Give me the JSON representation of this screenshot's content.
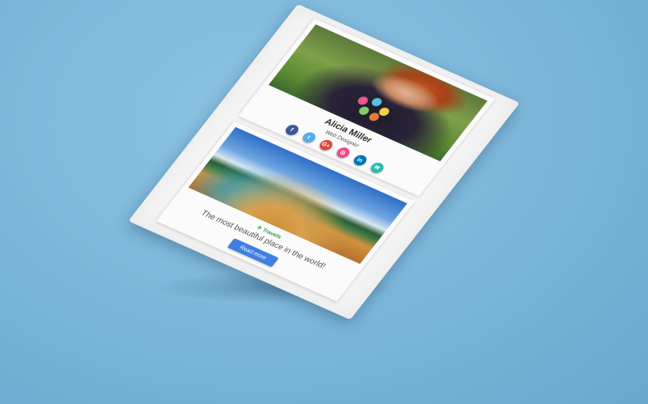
{
  "profile": {
    "name": "Alicia Miller",
    "role": "Web Designer",
    "social": [
      {
        "icon": "facebook-icon",
        "glyph": "f",
        "color": "#3b5998"
      },
      {
        "icon": "twitter-icon",
        "glyph": "t",
        "color": "#55acee"
      },
      {
        "icon": "google-plus-icon",
        "glyph": "G+",
        "color": "#dd4b39"
      },
      {
        "icon": "dribbble-icon",
        "glyph": "◎",
        "color": "#ea4c89"
      },
      {
        "icon": "linkedin-icon",
        "glyph": "in",
        "color": "#0077b5"
      },
      {
        "icon": "email-icon",
        "glyph": "✉",
        "color": "#2bbbad"
      }
    ]
  },
  "post": {
    "category": "Travels",
    "category_icon": "plane-icon",
    "caption": "The most beautiful place in the world!",
    "button": "Read more"
  },
  "colors": {
    "background": "#7fb9dd",
    "accent": "#3f7fe0",
    "category": "#3a9b4a"
  }
}
